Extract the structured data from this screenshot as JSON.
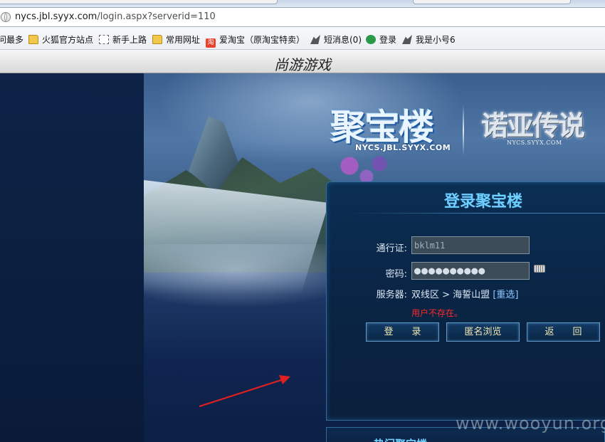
{
  "browser": {
    "url_host": "nycs.jbl.syyx.com",
    "url_path": "/login.aspx?serverid=110",
    "bookmarks": [
      {
        "label": "问最多",
        "icon": "none"
      },
      {
        "label": "火狐官方站点",
        "icon": "folder-icon"
      },
      {
        "label": "新手上路",
        "icon": "dashed-page-icon"
      },
      {
        "label": "常用网址",
        "icon": "folder-icon"
      },
      {
        "label": "爱淘宝（原淘宝特卖）",
        "icon": "taobao-icon"
      },
      {
        "label": "短消息(0)",
        "icon": "bird-icon"
      },
      {
        "label": "登录",
        "icon": "round-app-icon"
      },
      {
        "label": "我是小号6",
        "icon": "bird-icon"
      }
    ],
    "site_title": "尚游游戏"
  },
  "banner": {
    "portal_logo": "聚宝楼",
    "portal_domain": "NYCS.JBL.SYYX.COM",
    "game_logo": "诺亚传说",
    "game_domain": "NYCS.SYYX.COM"
  },
  "login": {
    "title": "登录聚宝楼",
    "passport_label": "通行证:",
    "passport_value": "bklm11",
    "password_label": "密码:",
    "password_value": "●●●●●●●●●●",
    "server_label": "服务器:",
    "server_value": "双线区 > 海誓山盟",
    "reselect_label": "[重选]",
    "error": "用户不存在。",
    "buttons": {
      "login": "登　　录",
      "anonymous": "匿名浏览",
      "back": "返　　回"
    }
  },
  "sub_panel_title": "热门聚宝楼",
  "watermark": "www.wooyun.org",
  "colors": {
    "accent_title": "#6fcfff",
    "error": "#ff2a2a",
    "annotation_arrow": "#e02020"
  }
}
